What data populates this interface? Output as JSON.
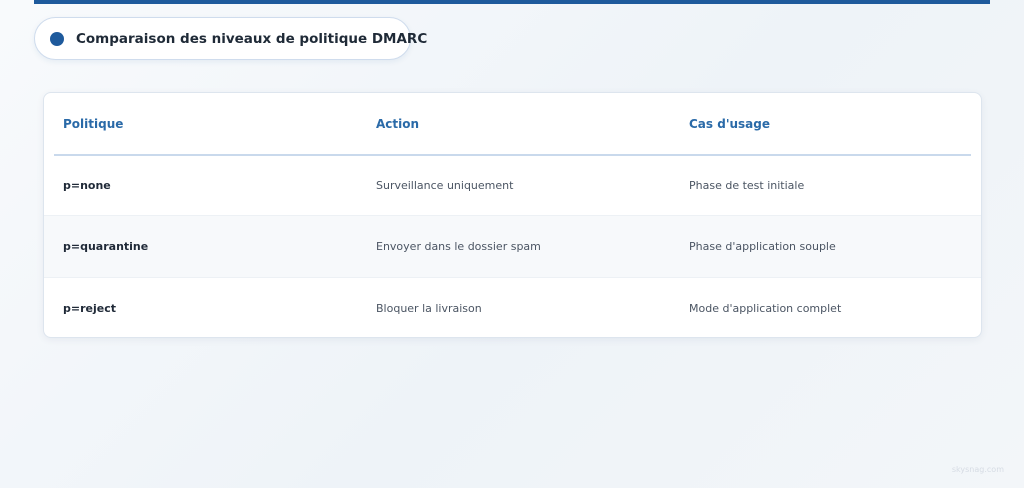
{
  "header": {
    "title": "Comparaison des niveaux de politique DMARC",
    "accent_color": "#1e5a9c"
  },
  "table": {
    "columns": [
      "Politique",
      "Action",
      "Cas d'usage"
    ],
    "rows": [
      [
        "p=none",
        "Surveillance uniquement",
        "Phase de test initiale"
      ],
      [
        "p=quarantine",
        "Envoyer dans le dossier spam",
        "Phase d'application souple"
      ],
      [
        "p=reject",
        "Bloquer la livraison",
        "Mode d'application complet"
      ]
    ]
  },
  "watermark": "skysnag.com",
  "colors": {
    "header_text": "#2a6aa8",
    "row_alt": "#f7f9fb"
  }
}
